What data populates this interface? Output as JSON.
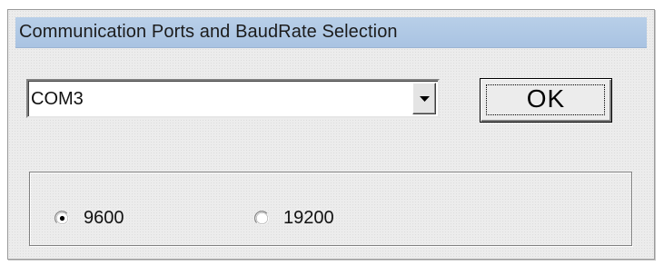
{
  "dialog": {
    "title": "Communication Ports and BaudRate Selection"
  },
  "port_select": {
    "value": "COM3",
    "icon": "chevron-down-icon"
  },
  "ok_button": {
    "label": "OK"
  },
  "baud_rate": {
    "options": [
      {
        "label": "9600",
        "selected": true
      },
      {
        "label": "19200",
        "selected": false
      }
    ]
  },
  "colors": {
    "title_bar": "#b1c9e5",
    "dialog_background": "#ececec"
  }
}
